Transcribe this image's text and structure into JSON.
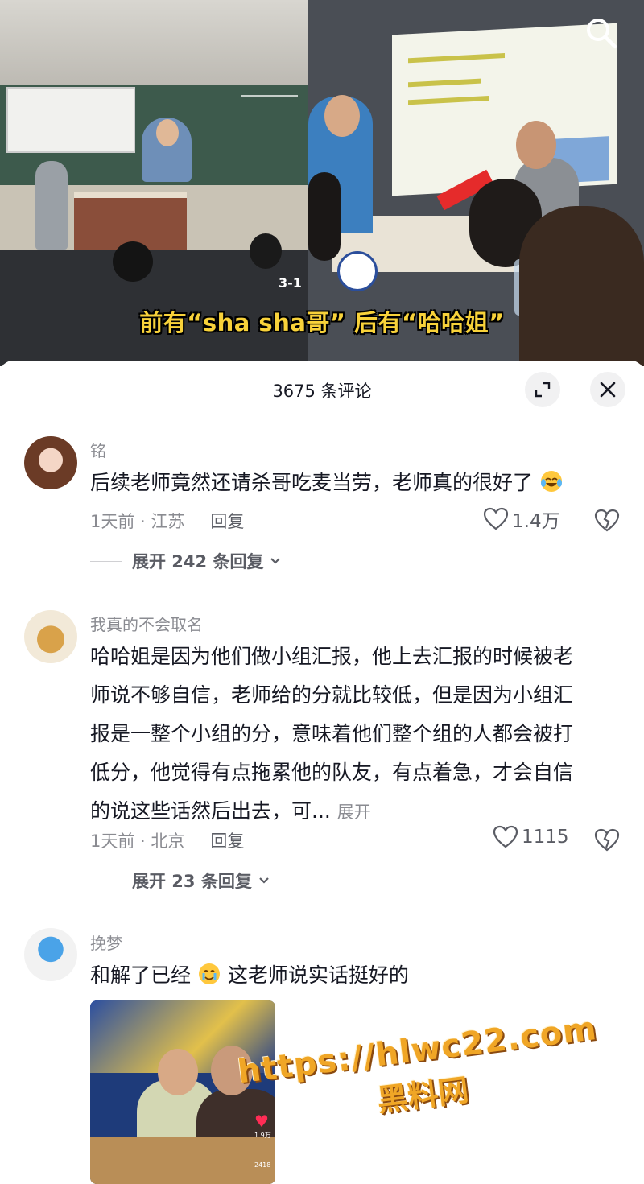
{
  "video": {
    "caption": "前有“sha sha哥” 后有“哈哈姐”",
    "timestamp": "3-1"
  },
  "comments_panel": {
    "title": "3675 条评论"
  },
  "comments": [
    {
      "username": "铭",
      "text": "后续老师竟然还请杀哥吃麦当劳，老师真的很好了",
      "emoji": "laughing-tears",
      "time_location": "1天前 · 江苏",
      "reply_label": "回复",
      "likes": "1.4万",
      "expand_replies": "展开 242 条回复"
    },
    {
      "username": "我真的不会取名",
      "text_lines": [
        "哈哈姐是因为他们做小组汇报，他上去汇报的时候被老",
        "师说不够自信，老师给的分就比较低，但是因为小组汇",
        "报是一整个小组的分，意味着他们整个组的人都会被打",
        "低分，他觉得有点拖累他的队友，有点着急，才会自信",
        "的说这些话然后出去，可..."
      ],
      "more_label": "展开",
      "time_location": "1天前 · 北京",
      "reply_label": "回复",
      "likes": "1115",
      "expand_replies": "展开 23 条回复"
    },
    {
      "username": "挽梦",
      "text_before": "和解了已经",
      "emoji": "crying-smile",
      "text_after": "这老师说实话挺好的",
      "image_counts": [
        "1.9万",
        "2418"
      ]
    }
  ],
  "watermark": {
    "url": "https://hlwc22.com",
    "site": "黑料网"
  },
  "colors": {
    "caption": "#f8d23a",
    "watermark": "#f0a626",
    "arrow": "#e52b2b",
    "secondary_text": "#8a8b91"
  }
}
